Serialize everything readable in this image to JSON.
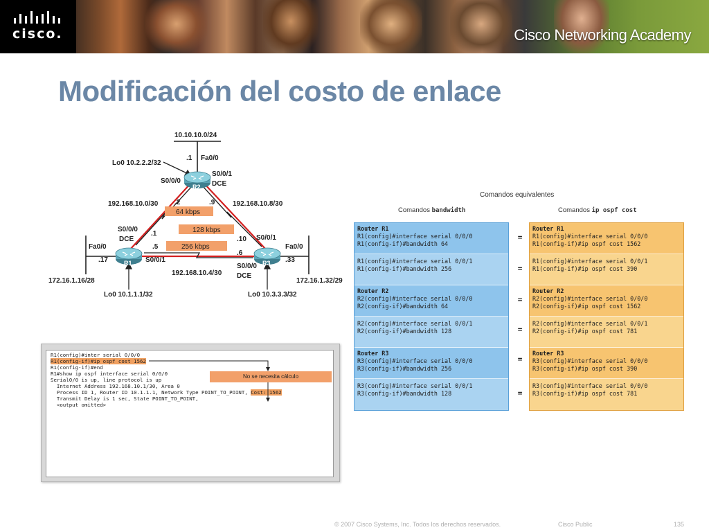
{
  "banner": {
    "logo_text": "cisco.",
    "academy_text": "Cisco Networking Academy"
  },
  "title": "Modificación del costo de enlace",
  "topology": {
    "r2_lan": "10.10.10.0/24",
    "r2_fa": "Fa0/0",
    "r2_fa_host": ".1",
    "r2_lo": "Lo0 10.2.2.2/32",
    "r2_s000": "S0/0/0",
    "r2_s001": "S0/0/1",
    "r2_dce": "DCE",
    "r2_name": "R2",
    "net_r1r2": "192.168.10.0/30",
    "net_r2r3": "192.168.10.8/30",
    "net_r1r3": "192.168.10.4/30",
    "h_r2_left": ".2",
    "h_r2_right": ".9",
    "h_r1_top": ".1",
    "h_r3_top": ".10",
    "h_r1_right": ".5",
    "h_r3_left": ".6",
    "bw_64": "64 kbps",
    "bw_128": "128 kbps",
    "bw_256": "256 kbps",
    "r1_s000": "S0/0/0",
    "r1_dce": "DCE",
    "r1_fa": "Fa0/0",
    "r1_fa_host": ".17",
    "r1_s001": "S0/0/1",
    "r1_name": "R1",
    "r1_lan": "172.16.1.16/28",
    "r1_lo": "Lo0 10.1.1.1/32",
    "r3_s001": "S0/0/1",
    "r3_fa": "Fa0/0",
    "r3_fa_host": ".33",
    "r3_s000": "S0/0/0",
    "r3_dce": "DCE",
    "r3_name": "R3",
    "r3_lan": "172.16.1.32/29",
    "r3_lo": "Lo0 10.3.3.3/32"
  },
  "cli": {
    "l1": "R1(config)#inter serial 0/0/0",
    "l2": "R1(config-if)#ip ospf cost 1562",
    "l3": "R1(config-if)#end",
    "l4": "R1#show ip ospf interface serial 0/0/0",
    "l5": "Serial0/0 is up, line protocol is up",
    "l6a": "  Internet Address 192.168.10.1/30, Area 0",
    "l7a": "  Process ID 1, Router ID 10.1.1.1, Network Type POINT_TO_POINT, ",
    "l7b": "Cost: 1562",
    "l8": "  Transmit Delay is 1 sec, State POINT_TO_POINT,",
    "l9": "  <output omitted>",
    "note": "No se necesita cálculo"
  },
  "compare": {
    "title": "Comandos equivalentes",
    "head_left_pre": "Comandos ",
    "head_left_mono": "bandwidth",
    "head_right_pre": "Comandos ",
    "head_right_mono": "ip ospf cost",
    "eq": "=",
    "left": [
      {
        "h": "Router R1",
        "a": "R1(config)#interface serial 0/0/0",
        "b": "R1(config-if)#bandwidth 64"
      },
      {
        "h": "",
        "a": "R1(config)#interface serial 0/0/1",
        "b": "R1(config-if)#bandwidth 256"
      },
      {
        "h": "Router R2",
        "a": "R2(config)#interface serial 0/0/0",
        "b": "R2(config-if)#bandwidth 64"
      },
      {
        "h": "",
        "a": "R2(config)#interface serial 0/0/1",
        "b": "R2(config-if)#bandwidth 128"
      },
      {
        "h": "Router R3",
        "a": "R3(config)#interface serial 0/0/0",
        "b": "R3(config-if)#bandwidth 256"
      },
      {
        "h": "",
        "a": "R3(config)#interface serial 0/0/1",
        "b": "R3(config-if)#bandwidth 128"
      }
    ],
    "right": [
      {
        "h": "Router R1",
        "a": "R1(config)#interface serial 0/0/0",
        "b": "R1(config-if)#ip ospf cost 1562"
      },
      {
        "h": "",
        "a": "R1(config)#interface serial 0/0/1",
        "b": "R1(config-if)#ip ospf cost 390"
      },
      {
        "h": "Router R2",
        "a": "R2(config)#interface serial 0/0/0",
        "b": "R2(config-if)#ip ospf cost 1562"
      },
      {
        "h": "",
        "a": "R2(config)#interface serial 0/0/1",
        "b": "R2(config-if)#ip ospf cost 781"
      },
      {
        "h": "Router R3",
        "a": "R3(config)#interface serial 0/0/0",
        "b": "R3(config-if)#ip ospf cost 390"
      },
      {
        "h": "",
        "a": "R3(config)#interface serial 0/0/0",
        "b": "R3(config-if)#ip ospf cost 781"
      }
    ]
  },
  "footer": {
    "copyright": "© 2007 Cisco Systems, Inc. Todos los derechos reservados.",
    "classification": "Cisco Public",
    "page": "135"
  }
}
